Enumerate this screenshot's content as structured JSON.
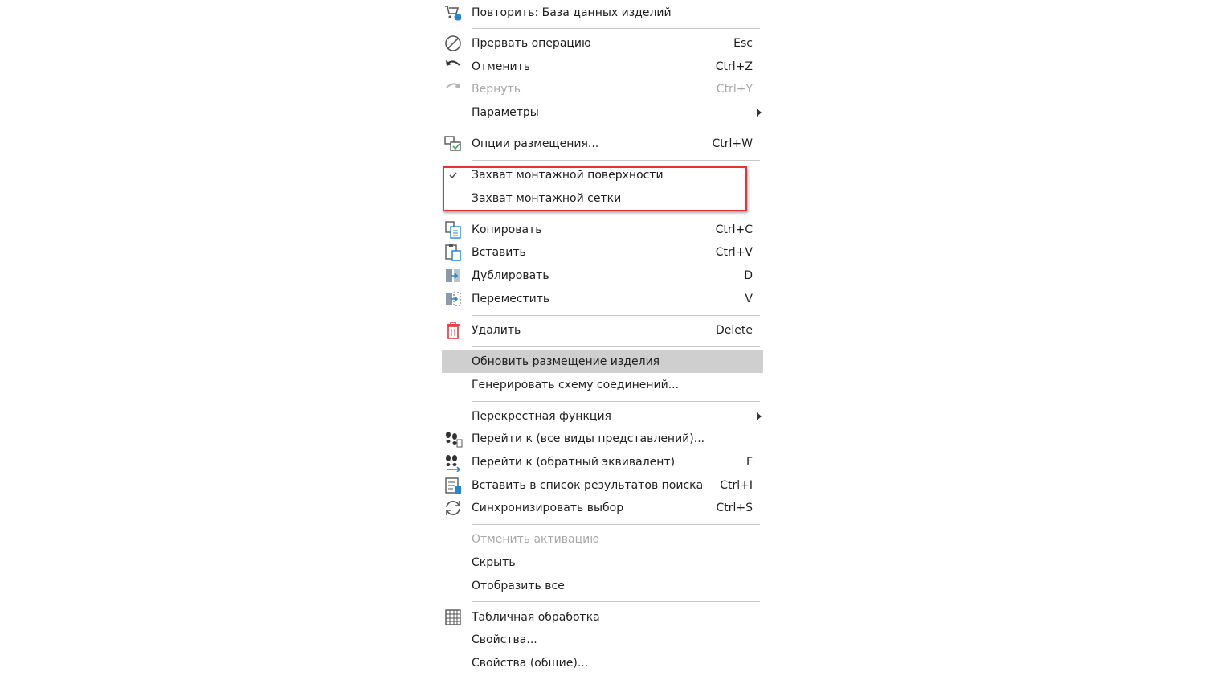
{
  "menu": {
    "repeat": {
      "label": "Повторить: База данных изделий",
      "icon": "cart-database-icon"
    },
    "abort": {
      "label": "Прервать операцию",
      "shortcut": "Esc",
      "icon": "abort-icon"
    },
    "undo": {
      "label": "Отменить",
      "shortcut": "Ctrl+Z",
      "icon": "undo-icon"
    },
    "redo": {
      "label": "Вернуть",
      "shortcut": "Ctrl+Y",
      "icon": "redo-icon",
      "disabled": true
    },
    "params": {
      "label": "Параметры",
      "submenu": true
    },
    "placement_options": {
      "label": "Опции размещения...",
      "shortcut": "Ctrl+W",
      "icon": "placement-options-icon"
    },
    "snap_surface": {
      "label": "Захват монтажной поверхности",
      "checked": true
    },
    "snap_grid": {
      "label": "Захват монтажной сетки",
      "checked": false
    },
    "copy": {
      "label": "Копировать",
      "shortcut": "Ctrl+C",
      "icon": "copy-icon"
    },
    "paste": {
      "label": "Вставить",
      "shortcut": "Ctrl+V",
      "icon": "paste-icon"
    },
    "duplicate": {
      "label": "Дублировать",
      "shortcut": "D",
      "icon": "duplicate-icon"
    },
    "move": {
      "label": "Переместить",
      "shortcut": "V",
      "icon": "move-icon"
    },
    "delete": {
      "label": "Удалить",
      "shortcut": "Delete",
      "icon": "trash-icon"
    },
    "update_placement": {
      "label": "Обновить размещение изделия",
      "highlighted": true
    },
    "generate_schema": {
      "label": "Генерировать схему соединений..."
    },
    "cross_function": {
      "label": "Перекрестная функция",
      "submenu": true
    },
    "goto_all": {
      "label": "Перейти к (все виды представлений)...",
      "icon": "footsteps-icon"
    },
    "goto_reverse": {
      "label": "Перейти к (обратный эквивалент)",
      "shortcut": "F",
      "icon": "footsteps-reverse-icon"
    },
    "insert_search": {
      "label": "Вставить в список результатов поиска",
      "shortcut": "Ctrl+I",
      "icon": "search-results-list-icon"
    },
    "sync_selection": {
      "label": "Синхронизировать выбор",
      "shortcut": "Ctrl+S",
      "icon": "sync-icon"
    },
    "cancel_activation": {
      "label": "Отменить активацию",
      "disabled": true
    },
    "hide": {
      "label": "Скрыть"
    },
    "show_all": {
      "label": "Отобразить все"
    },
    "table_edit": {
      "label": "Табличная обработка",
      "icon": "table-grid-icon"
    },
    "properties": {
      "label": "Свойства..."
    },
    "properties_common": {
      "label": "Свойства (общие)..."
    }
  },
  "colors": {
    "accent_blue": "#1e88d6",
    "delete_red": "#e8323a",
    "highlight": "#cfcfcf",
    "annotation": "#e8323a"
  }
}
